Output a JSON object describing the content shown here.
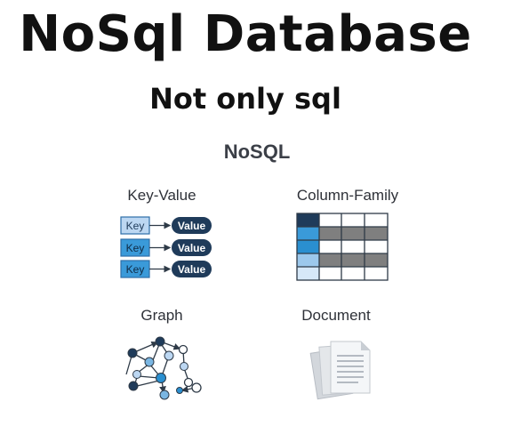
{
  "page": {
    "title": "NoSql Database",
    "subtitle": "Not only sql"
  },
  "diagram": {
    "heading": "NoSQL",
    "categories": [
      {
        "id": "key-value",
        "label": "Key-Value"
      },
      {
        "id": "column-family",
        "label": "Column-Family"
      },
      {
        "id": "graph",
        "label": "Graph"
      },
      {
        "id": "document",
        "label": "Document"
      }
    ],
    "key_value": {
      "key_text": "Key",
      "value_text": "Value",
      "pairs": 3
    },
    "colors": {
      "dark_navy": "#1f3b5a",
      "light_blue": "#bcd7f2",
      "mid_blue": "#2a8fd0",
      "grey": "#7f7f7f",
      "outline": "#2e3a47"
    }
  }
}
